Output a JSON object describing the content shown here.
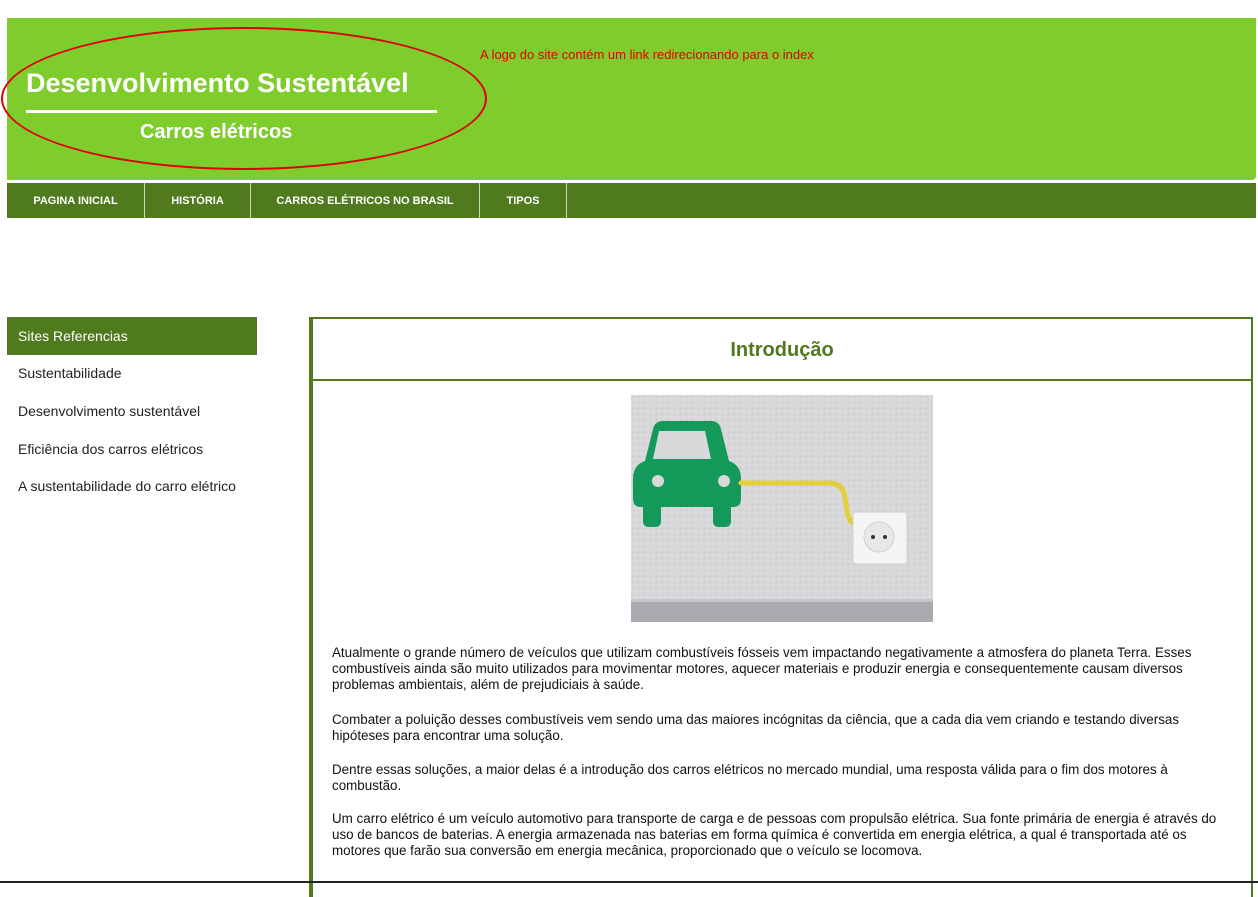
{
  "header": {
    "title": "Desenvolvimento Sustentável",
    "subtitle": "Carros elétricos",
    "annotation": "A logo do site contém um link redirecionando para o index"
  },
  "nav": {
    "items": [
      {
        "label": "PAGINA INICIAL"
      },
      {
        "label": "HISTÓRIA"
      },
      {
        "label": "CARROS ELÉTRICOS NO BRASIL"
      },
      {
        "label": "TIPOS"
      }
    ]
  },
  "sidebar": {
    "heading": "Sites Referencias",
    "links": [
      {
        "label": "Sustentabilidade"
      },
      {
        "label": "Desenvolvimento sustentável"
      },
      {
        "label": "Eficiência dos carros elétricos"
      },
      {
        "label": "A sustentabilidade do carro elétrico"
      }
    ]
  },
  "main": {
    "title": "Introdução",
    "image": {
      "icon": "electric-car-plug-icon"
    },
    "paragraphs": [
      "Atualmente o grande número de veículos que utilizam combustíveis fósseis vem impactando negativamente a atmosfera do planeta Terra. Esses combustíveis ainda são muito utilizados para movimentar motores, aquecer materiais e produzir energia e consequentemente causam diversos problemas ambientais, além de prejudiciais à saúde.",
      "Combater a poluição desses combustíveis vem sendo uma das maiores incógnitas da ciência, que a cada dia vem criando e testando diversas hipóteses para encontrar uma solução.",
      "Dentre essas soluções, a maior delas é a introdução dos carros elétricos no mercado mundial, uma resposta válida para o fim dos motores à combustão.",
      "Um carro elétrico é um veículo automotivo para transporte de carga e de pessoas com propulsão elétrica. Sua fonte primária de energia é através do uso de bancos de baterias. A energia armazenada nas baterias em forma química é convertida em energia elétrica, a qual é transportada até os motores que farão sua conversão em energia mecânica, proporcionado que o veículo se locomova."
    ]
  },
  "colors": {
    "header_green": "#7fcc2d",
    "dark_green": "#4f7a1e",
    "annotation_red": "#e00000"
  }
}
